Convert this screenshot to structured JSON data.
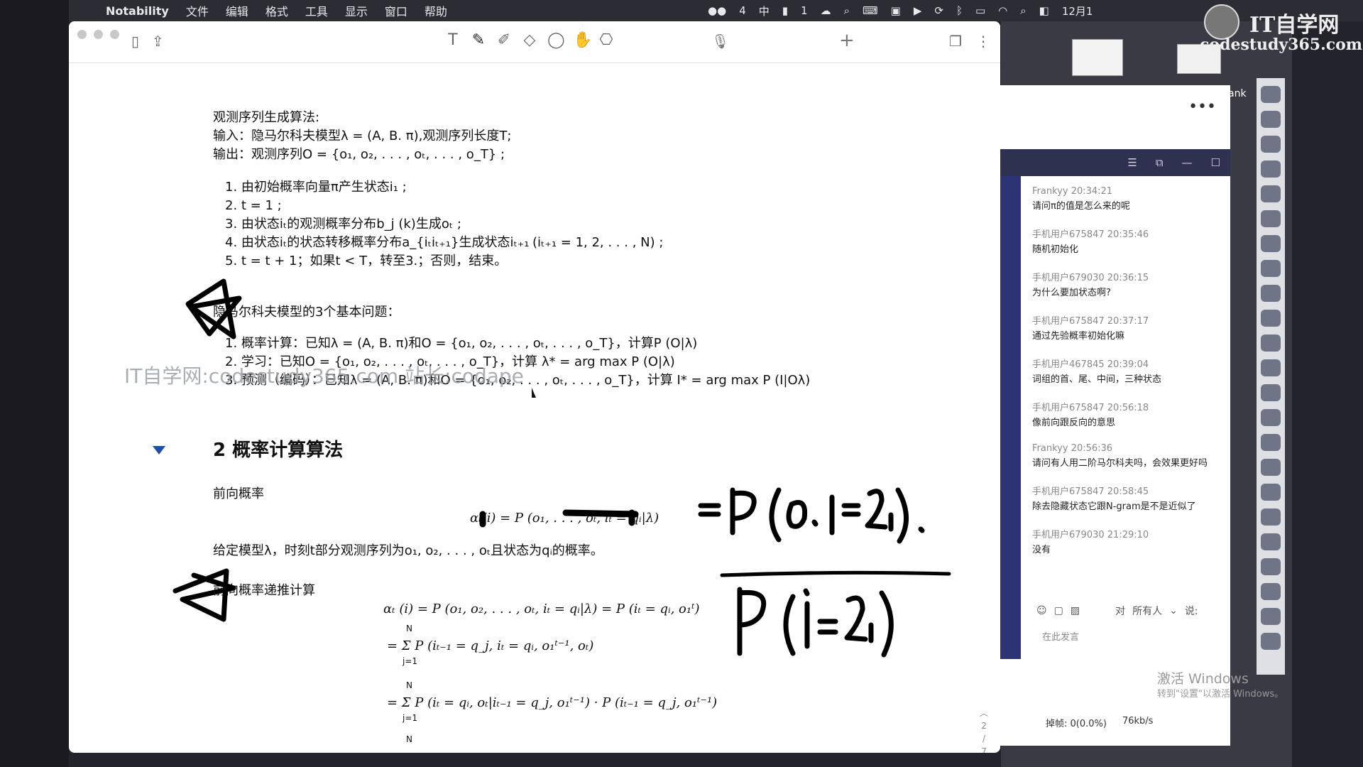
{
  "menubar": {
    "app": "Notability",
    "items": [
      "文件",
      "编辑",
      "格式",
      "工具",
      "显示",
      "窗口",
      "帮助"
    ],
    "status_items": [
      "4",
      "中",
      "1"
    ],
    "date": "12月1"
  },
  "watermark": {
    "line1": "IT自学网",
    "line2": "codestudy365.com",
    "overlay": "IT自学网:codestudy365.com 站长:codape"
  },
  "chat": {
    "header_more": "•••",
    "header_ank": "ank",
    "messages": [
      {
        "user": "Frankyy",
        "time": "20:34:21",
        "text": "请问π的值是怎么来的呢"
      },
      {
        "user": "手机用户675847",
        "time": "20:35:46",
        "text": "随机初始化"
      },
      {
        "user": "手机用户679030",
        "time": "20:36:15",
        "text": "为什么要加状态啊?"
      },
      {
        "user": "手机用户675847",
        "time": "20:37:17",
        "text": "通过先验概率初始化嘛"
      },
      {
        "user": "手机用户467845",
        "time": "20:39:04",
        "text": "词组的首、尾、中间，三种状态"
      },
      {
        "user": "手机用户675847",
        "time": "20:56:18",
        "text": "像前向跟反向的意思"
      },
      {
        "user": "Frankyy",
        "time": "20:56:36",
        "text": "请问有人用二阶马尔科夫吗，会效果更好吗"
      },
      {
        "user": "手机用户675847",
        "time": "20:58:45",
        "text": "除去隐藏状态它跟N-gram是不是近似了"
      },
      {
        "user": "手机用户679030",
        "time": "21:29:10",
        "text": "没有"
      }
    ],
    "to_label": "对",
    "to_value": "所有人",
    "say_label": "说:",
    "input_placeholder": "在此发言",
    "drop_label": "掉帧: 0(0.0%)",
    "speed": "76kb/s",
    "win_activate": "激活 Windows",
    "win_activate_sub": "转到\"设置\"以激活 Windows。"
  },
  "doc": {
    "alg_title": "观测序列生成算法:",
    "input_line": "输入：隐马尔科夫模型λ = (A, B. π),观测序列长度T;",
    "output_line": "输出：观测序列O = {o₁, o₂, . . . , oₜ, . . . , o_T} ;",
    "steps": [
      "1. 由初始概率向量π产生状态i₁ ;",
      "2. t = 1 ;",
      "3. 由状态iₜ的观测概率分布b_j (k)生成oₜ ;",
      "4. 由状态iₜ的状态转移概率分布a_{iₜiₜ₊₁}生成状态iₜ₊₁",
      "5. t = t + 1；如果t < T，转至3.；否则，结束。"
    ],
    "step4_tail": "(iₜ₊₁ = 1, 2, . . . , N) ;",
    "problems_title": "隐马尔科夫模型的3个基本问题：",
    "problems": [
      "1. 概率计算：已知λ = (A, B. π)和O = {o₁, o₂, . . . , oₜ, . . . , o_T}，计算P (O|λ)",
      "2. 学习：已知O = {o₁, o₂, . . . , oₜ, . . . , o_T}，计算 λ* = arg max P (O|λ)",
      "3. 预测（编码）：已知λ = (A, B. π)和O = {o₁, o₂, . . . , oₜ, . . . , o_T}，计算 I* = arg max P (I|Oλ)"
    ],
    "section_title": "2 概率计算算法",
    "forward_label": "前向概率",
    "forward_eq": "αₜ(i) = P (o₁, . . . , oₜ, iₜ = qᵢ|λ)",
    "forward_desc": "给定模型λ，时刻t部分观测序列为o₁, o₂, . . . , oₜ且状态为qᵢ的概率。",
    "recur_label": "前向概率递推计算",
    "recur_eq1": "αₜ (i) = P (o₁, o₂, . . . , oₜ, iₜ = qᵢ|λ) = P (iₜ = qᵢ, o₁ᵗ)",
    "recur_eq2": "= Σ P (iₜ₋₁ = q_j, iₜ = qᵢ, o₁ᵗ⁻¹, oₜ)",
    "recur_eq3": "= Σ P (iₜ = qᵢ, oₜ|iₜ₋₁ = q_j, o₁ᵗ⁻¹) · P (iₜ₋₁ = q_j, o₁ᵗ⁻¹)",
    "sum_top": "N",
    "sum_bottom": "j=1",
    "page_indicator": [
      "2",
      "7"
    ]
  }
}
